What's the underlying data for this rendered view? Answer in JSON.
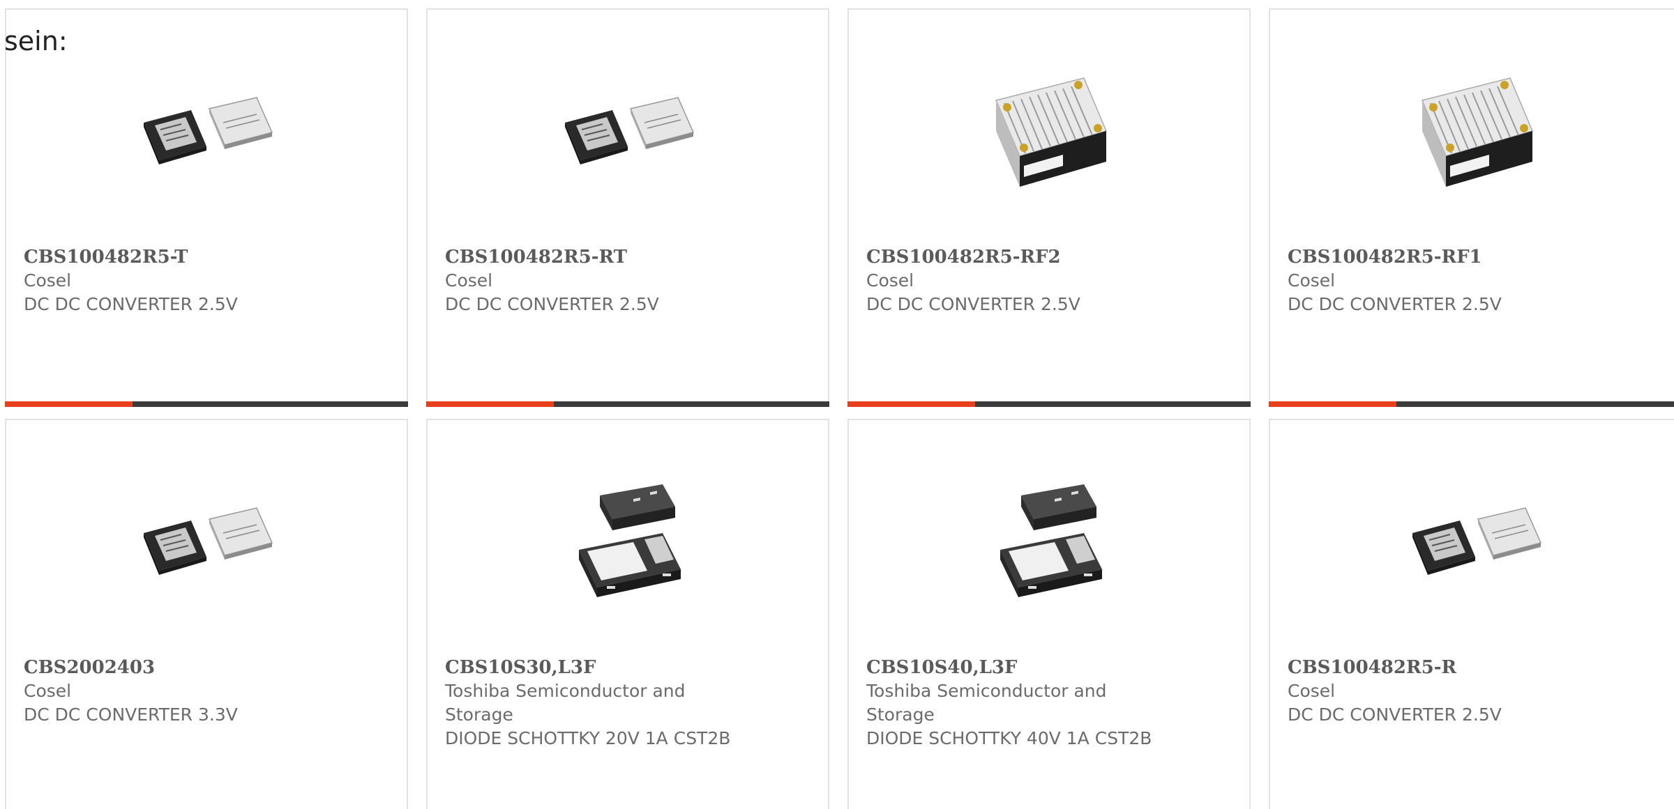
{
  "intro_text": "sein:",
  "colors": {
    "accent": "#e8401c",
    "bar_dark": "#3b3b3b",
    "card_border": "#e3e3e3"
  },
  "products": [
    {
      "part_number": "CBS100482R5-T",
      "manufacturer": "Cosel",
      "description": "DC DC CONVERTER 2.5V",
      "image": "dc-dc-module-pair-icon"
    },
    {
      "part_number": "CBS100482R5-RT",
      "manufacturer": "Cosel",
      "description": "DC DC CONVERTER 2.5V",
      "image": "dc-dc-module-pair-icon"
    },
    {
      "part_number": "CBS100482R5-RF2",
      "manufacturer": "Cosel",
      "description": "DC DC CONVERTER 2.5V",
      "image": "heatsink-module-icon"
    },
    {
      "part_number": "CBS100482R5-RF1",
      "manufacturer": "Cosel",
      "description": "DC DC CONVERTER 2.5V",
      "image": "heatsink-module-icon"
    },
    {
      "part_number": "CBS2002403",
      "manufacturer": "Cosel",
      "description": "DC DC CONVERTER 3.3V",
      "image": "dc-dc-module-pair-icon"
    },
    {
      "part_number": "CBS10S30,L3F",
      "manufacturer": "Toshiba Semiconductor and Storage",
      "description": "DIODE SCHOTTKY 20V 1A CST2B",
      "image": "smd-diode-package-icon"
    },
    {
      "part_number": "CBS10S40,L3F",
      "manufacturer": "Toshiba Semiconductor and Storage",
      "description": "DIODE SCHOTTKY 40V 1A CST2B",
      "image": "smd-diode-package-icon"
    },
    {
      "part_number": "CBS100482R5-R",
      "manufacturer": "Cosel",
      "description": "DC DC CONVERTER 2.5V",
      "image": "dc-dc-module-pair-icon"
    }
  ]
}
